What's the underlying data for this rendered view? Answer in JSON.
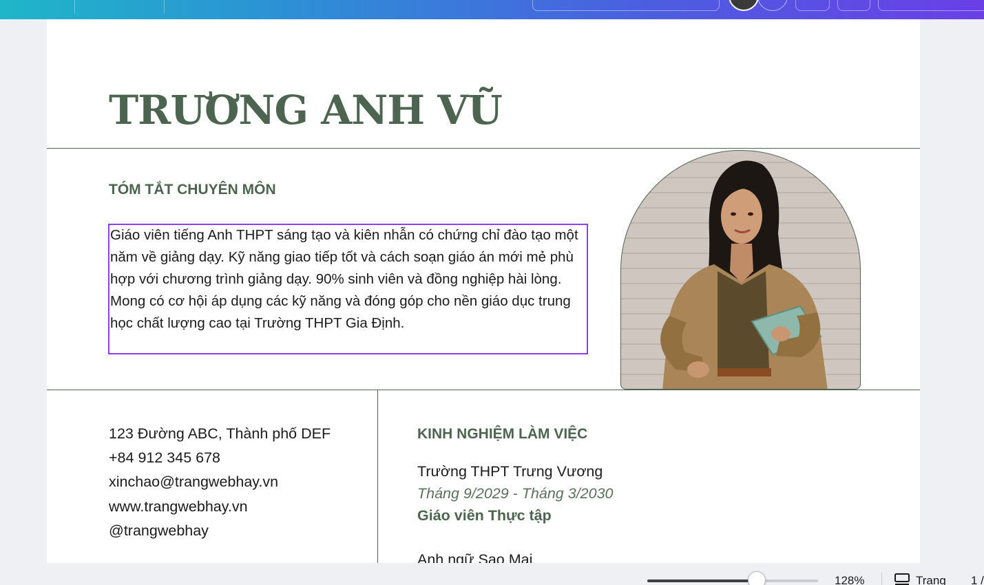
{
  "resume": {
    "name": "TRƯƠNG ANH VŨ",
    "summary_title": "TÓM TẮT CHUYÊN MÔN",
    "summary_text": "Giáo viên tiếng Anh THPT sáng tạo và kiên nhẫn có chứng chỉ đào tạo một năm về giảng dạy. Kỹ năng giao tiếp tốt và cách soạn giáo án mới mẻ phù hợp với chương trình giảng dạy. 90% sinh viên và đồng nghiệp hài lòng. Mong có cơ hội áp dụng các kỹ năng và đóng góp cho nền giáo dục trung học chất lượng cao tại Trường THPT Gia Định.",
    "contact": {
      "address": "123 Đường ABC, Thành phố DEF",
      "phone": "+84 912 345 678",
      "email": "xinchao@trangwebhay.vn",
      "website": "www.trangwebhay.vn",
      "social": "@trangwebhay"
    },
    "experience_title": "KINH NGHIỆM LÀM VIỆC",
    "jobs": [
      {
        "company": "Trường THPT Trưng Vương",
        "dates": "Tháng 9/2029 - Tháng 3/2030",
        "role": "Giáo viên Thực tập"
      },
      {
        "company": "Anh ngữ Sao Mai"
      }
    ]
  },
  "statusbar": {
    "zoom_label": "128%",
    "zoom_fraction": 0.64,
    "pages_label": "Trang",
    "page_count": "1 /"
  },
  "colors": {
    "accent_green": "#4d6550",
    "selection": "#8b3dff",
    "toolbar_gradient_start": "#1fb6c8",
    "toolbar_gradient_end": "#6a3fe6"
  }
}
